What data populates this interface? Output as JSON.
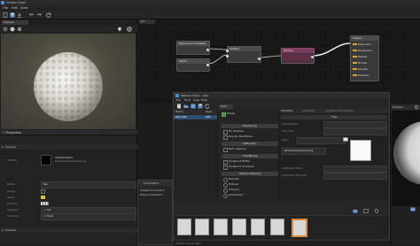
{
  "app": {
    "title": "Shader Graph",
    "menu": [
      "File",
      "Edit",
      "View"
    ]
  },
  "preview_panel": {
    "tab": "Preview"
  },
  "graph_tab": {
    "label": "Cd"
  },
  "graph": {
    "nodes": {
      "texture_coordinates": "Texture Coordinates",
      "vector": "Vector",
      "multiply": "Multiply",
      "texture": "Texture",
      "output": "Output"
    },
    "output_channels": [
      "Base Color",
      "Roughness",
      "Metallic",
      "Normal",
      "Opacity",
      "Emissive"
    ]
  },
  "properties_panel": {
    "tab": "Properties",
    "section": "General",
    "texture_label": "Texture",
    "texture_name": "checkerboard",
    "texture_path": "textures/checkerboard.png",
    "rows": [
      {
        "label": "Name",
        "value": "Tex"
      },
      {
        "label": "Group",
        "value": ""
      },
      {
        "label": "Value",
        "value": ""
      },
      {
        "label": "Default",
        "value": ""
      },
      {
        "label": "Exposed",
        "value": "Yes"
      },
      {
        "label": "Precision",
        "value": "Float"
      }
    ],
    "bottom_section": "Sampler"
  },
  "code_editor": {
    "title": "Code Editor",
    "items": [
      "Create Connection",
      "Draw Connection"
    ]
  },
  "material_editor": {
    "title": "Material Editor - test",
    "menu": [
      "File",
      "Tools",
      "View",
      "Help"
    ],
    "tab": "test*",
    "sidebar": {
      "header": "Name",
      "header_right": "Type",
      "item": "test.mat",
      "item_type": "Mat"
    },
    "center_toggle": "Shade",
    "sections": [
      {
        "title": "Rendering",
        "items": [
          "No Shadow",
          "Render Backfaces"
        ]
      },
      {
        "title": "Reflection",
        "items": [
          "Refl. Capture"
        ]
      },
      {
        "title": "Z Buffering",
        "items": [
          "Disable Z Buffer",
          "Disable Z Compare"
        ]
      },
      {
        "title": "Texture Filtering",
        "items": [
          "Nearest",
          "Bilinear",
          "Trilinear",
          "Anisotropic"
        ]
      }
    ],
    "variables_tabs": [
      "Variables",
      "Attributes",
      "Constant Parameters"
    ],
    "fog": {
      "header": "Fog",
      "enabled_label": "Fog Enabled",
      "color_label": "Fog Color",
      "type_label": "Type",
      "path_label": "Texture",
      "path_value": "textures/checkerboard.png",
      "lightmap_label": "Lightmap Mode",
      "strength_label": "Lightmap Strength"
    },
    "preview_tab": "Preview",
    "thumbnail_count": 7
  },
  "status_bar": {
    "text": "Hidden  Scene: Ball"
  },
  "colors": {
    "accent_orange": "#e08a3c",
    "texture_node": "#7a3b5a",
    "graph_bg": "#171717"
  }
}
